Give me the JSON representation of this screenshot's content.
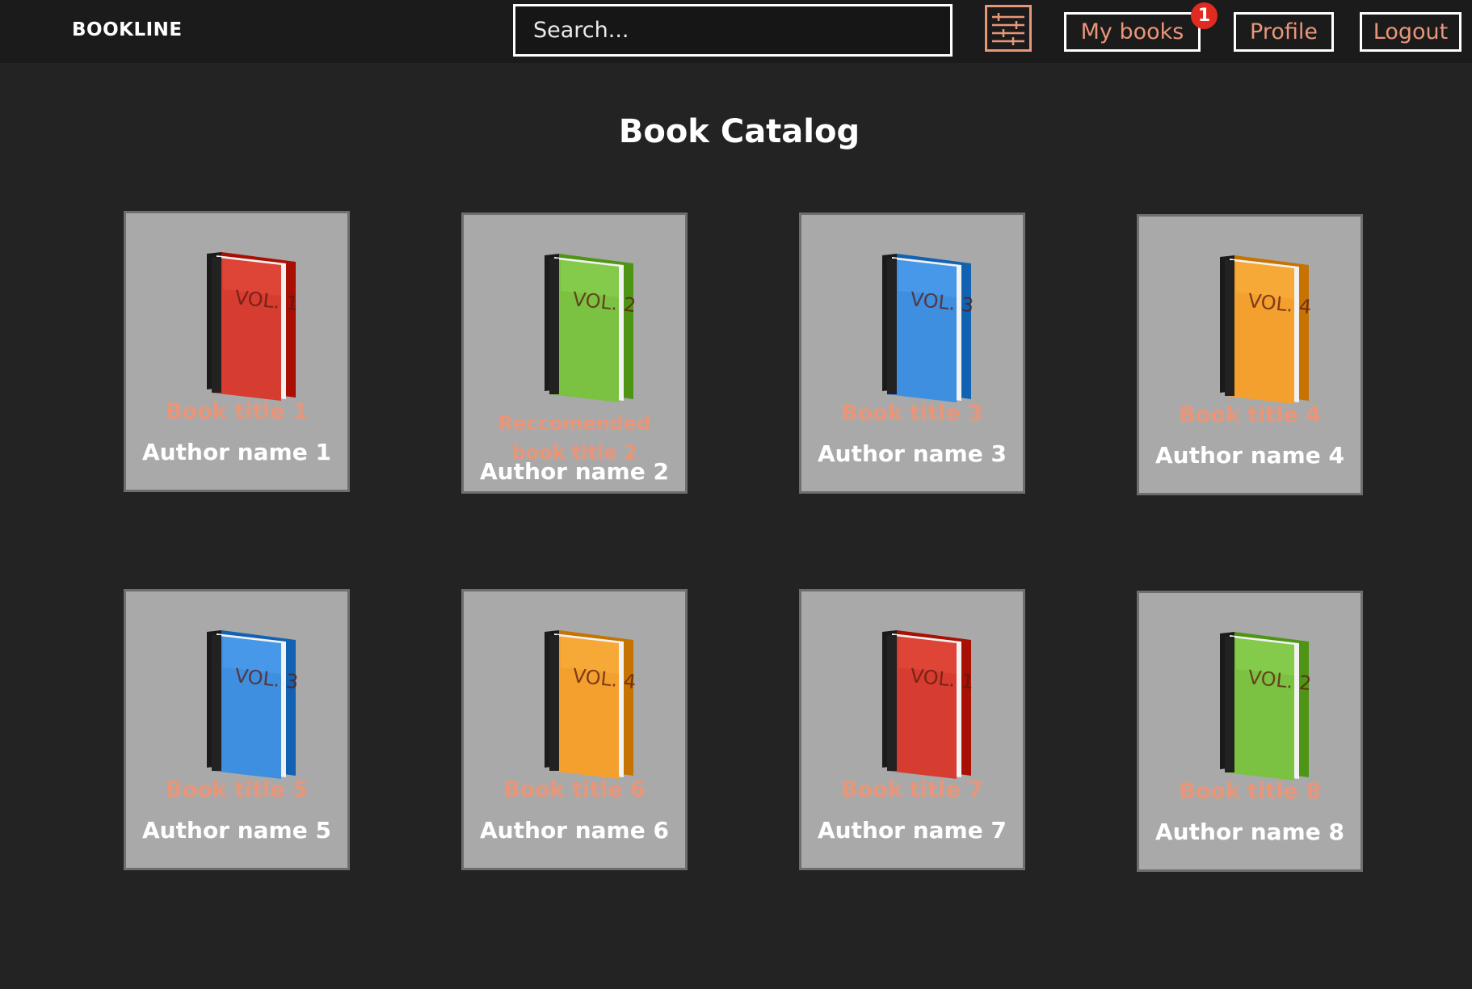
{
  "header": {
    "brand": "BOOKLINE",
    "search_placeholder": "Search...",
    "filter_icon": "sliders-icon",
    "my_books_label": "My books",
    "my_books_badge": "1",
    "profile_label": "Profile",
    "logout_label": "Logout"
  },
  "catalog": {
    "title": "Book Catalog",
    "books": [
      {
        "title": "Book title 1",
        "author": "Author name 1",
        "color": "#d63c2f",
        "vol": "VOL. 1"
      },
      {
        "title": "Reccomended book title 2",
        "author": "Author name 2",
        "color": "#7cc242",
        "vol": "VOL. 2"
      },
      {
        "title": "Book title 3",
        "author": "Author name 3",
        "color": "#3f8fe0",
        "vol": "VOL. 3"
      },
      {
        "title": "Book title 4",
        "author": "Author name 4",
        "color": "#f3a02e",
        "vol": "VOL. 4"
      },
      {
        "title": "Book title 5",
        "author": "Author name 5",
        "color": "#3f8fe0",
        "vol": "VOL. 3"
      },
      {
        "title": "Book title 6",
        "author": "Author name 6",
        "color": "#f3a02e",
        "vol": "VOL. 4"
      },
      {
        "title": "Book title 7",
        "author": "Author name 7",
        "color": "#d63c2f",
        "vol": "VOL. 1"
      },
      {
        "title": "Book title 8",
        "author": "Author name 8",
        "color": "#7cc242",
        "vol": "VOL. 2"
      }
    ]
  },
  "colors": {
    "background": "#232323",
    "topbar": "#1b1b1b",
    "accent": "#e8967a",
    "card": "#a9a9a9",
    "badge": "#e02b20"
  }
}
